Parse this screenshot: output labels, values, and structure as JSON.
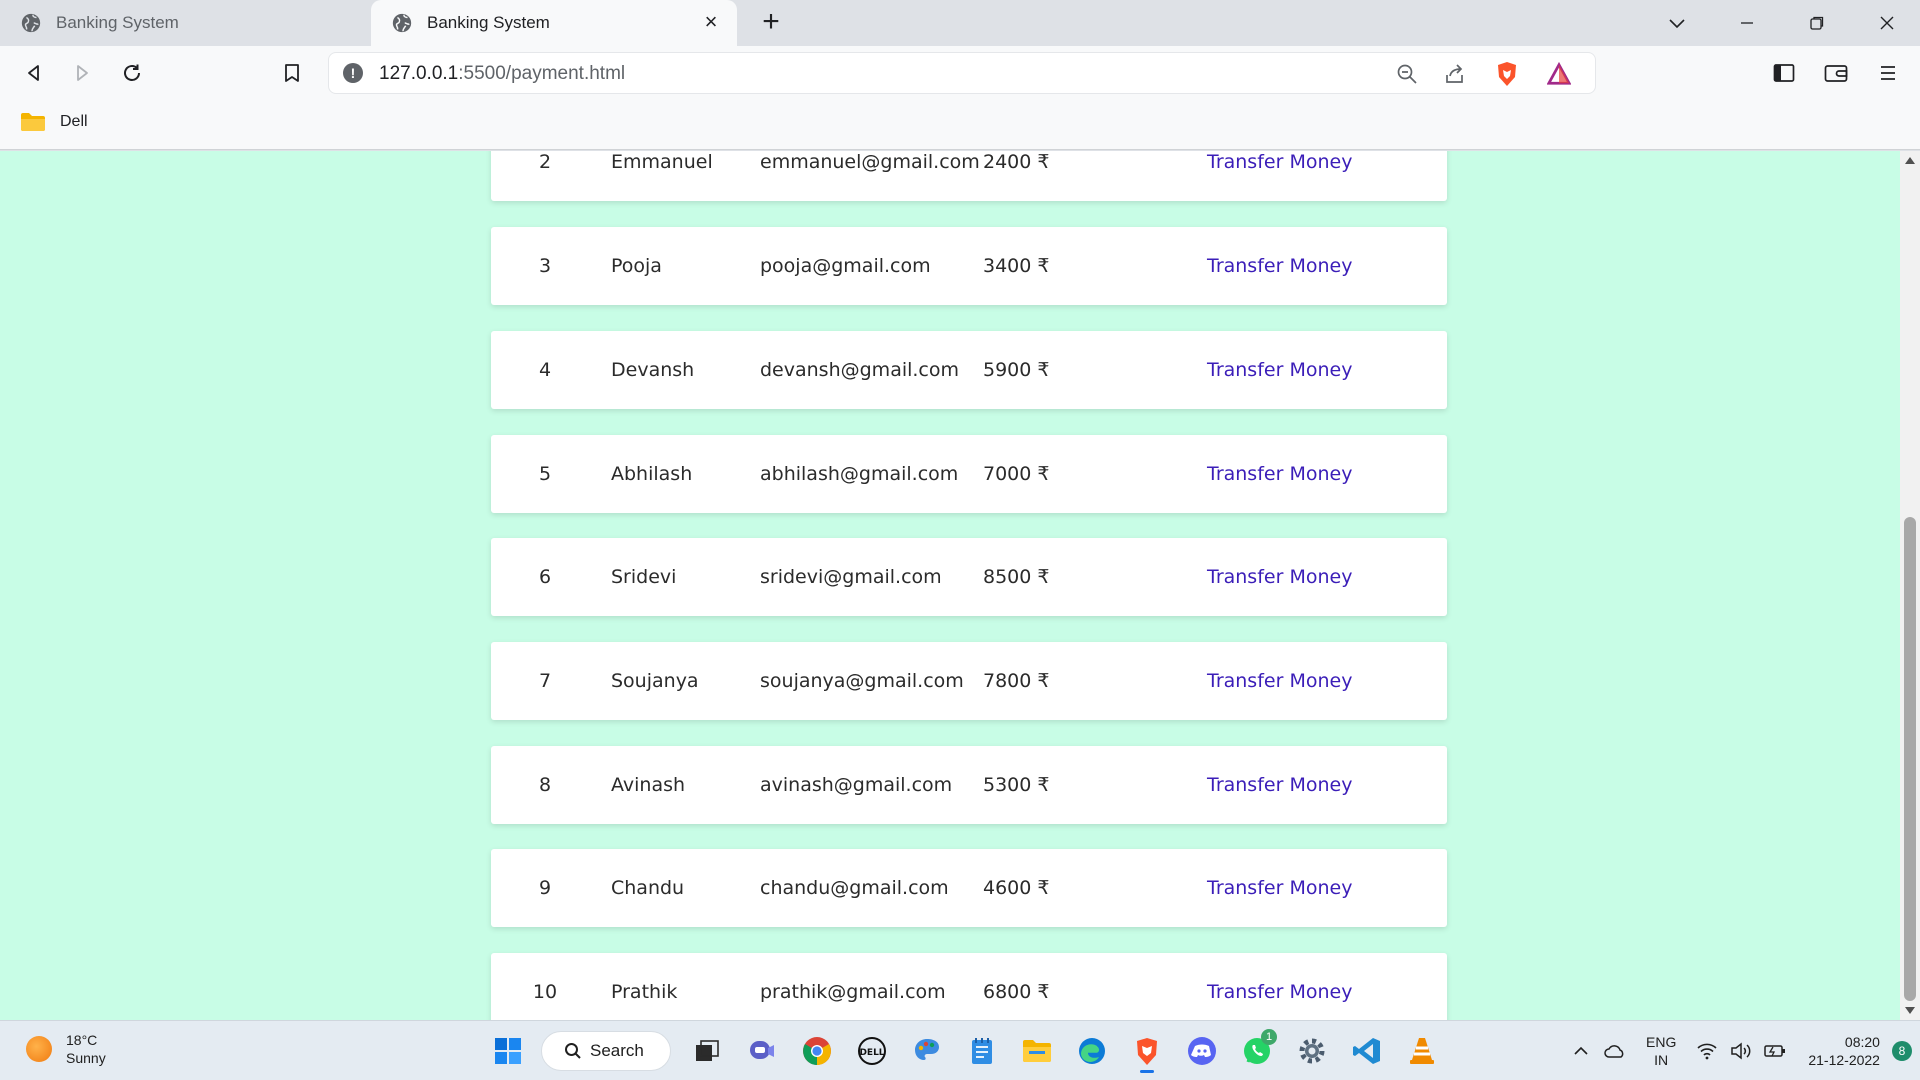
{
  "tabs": [
    {
      "title": "Banking System",
      "active": false
    },
    {
      "title": "Banking System",
      "active": true
    }
  ],
  "address": {
    "host": "127.0.0.1",
    "path": ":5500/payment.html"
  },
  "bookmarks": [
    {
      "label": "Dell"
    }
  ],
  "customers": [
    {
      "id": "2",
      "name": "Emmanuel",
      "email": "emmanuel@gmail.com",
      "balance": "2400 ₹",
      "action": "Transfer Money"
    },
    {
      "id": "3",
      "name": "Pooja",
      "email": "pooja@gmail.com",
      "balance": "3400 ₹",
      "action": "Transfer Money"
    },
    {
      "id": "4",
      "name": "Devansh",
      "email": "devansh@gmail.com",
      "balance": "5900 ₹",
      "action": "Transfer Money"
    },
    {
      "id": "5",
      "name": "Abhilash",
      "email": "abhilash@gmail.com",
      "balance": "7000 ₹",
      "action": "Transfer Money"
    },
    {
      "id": "6",
      "name": "Sridevi",
      "email": "sridevi@gmail.com",
      "balance": "8500 ₹",
      "action": "Transfer Money"
    },
    {
      "id": "7",
      "name": "Soujanya",
      "email": "soujanya@gmail.com",
      "balance": "7800 ₹",
      "action": "Transfer Money"
    },
    {
      "id": "8",
      "name": "Avinash",
      "email": "avinash@gmail.com",
      "balance": "5300 ₹",
      "action": "Transfer Money"
    },
    {
      "id": "9",
      "name": "Chandu",
      "email": "chandu@gmail.com",
      "balance": "4600 ₹",
      "action": "Transfer Money"
    },
    {
      "id": "10",
      "name": "Prathik",
      "email": "prathik@gmail.com",
      "balance": "6800 ₹",
      "action": "Transfer Money"
    }
  ],
  "colors": {
    "page_bg": "#c8fde6",
    "link": "#3b1eb8"
  },
  "taskbar": {
    "weather": {
      "temp": "18°C",
      "condition": "Sunny"
    },
    "search_label": "Search",
    "whatsapp_badge": "1",
    "lang": {
      "line1": "ENG",
      "line2": "IN"
    },
    "clock": {
      "time": "08:20",
      "date": "21-12-2022"
    },
    "notifications": "8"
  }
}
